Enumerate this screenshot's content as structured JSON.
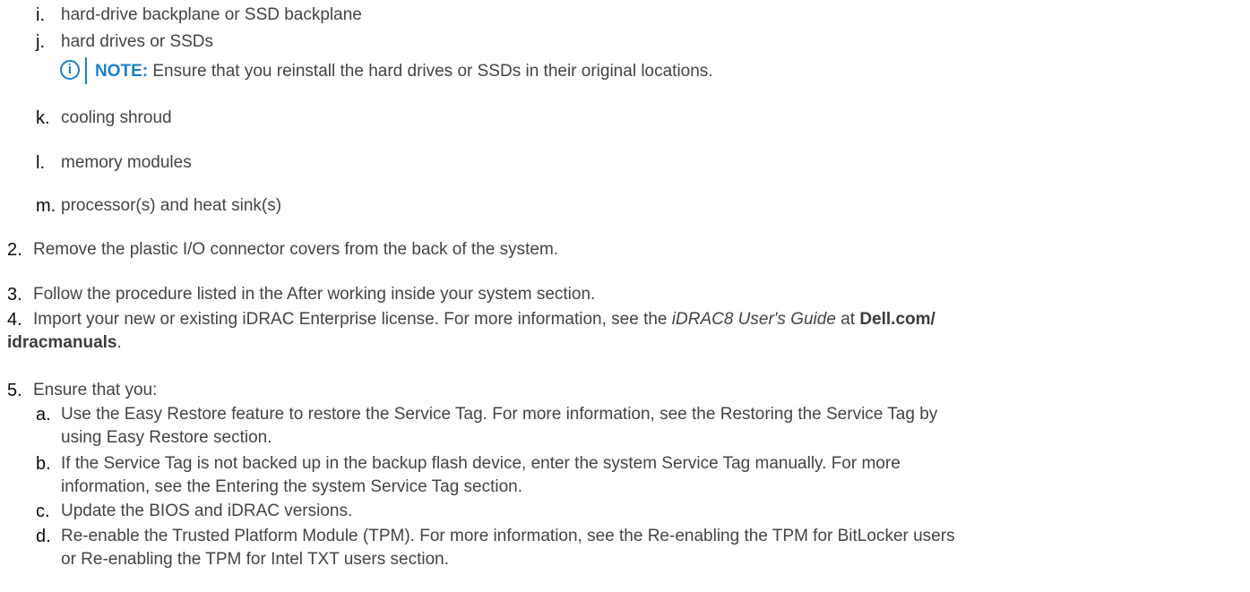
{
  "sub_items_top": [
    {
      "marker": "i.",
      "text": "hard-drive backplane or SSD backplane"
    },
    {
      "marker": "j.",
      "text": "hard drives or SSDs"
    }
  ],
  "note": {
    "icon": "info-icon",
    "label": "NOTE:",
    "text": " Ensure that you reinstall the hard drives or SSDs in their original locations."
  },
  "sub_items_bottom": [
    {
      "marker": "k.",
      "text": "cooling shroud"
    },
    {
      "marker": "l.",
      "text": "memory modules"
    },
    {
      "marker": "m.",
      "text": "processor(s) and heat sink(s)"
    }
  ],
  "steps": {
    "s2": {
      "marker": "2.",
      "text": "Remove the plastic I/O connector covers from the back of the system."
    },
    "s3": {
      "marker": "3.",
      "text": "Follow the procedure listed in the After working inside your system section."
    },
    "s4": {
      "marker": "4.",
      "text_a": "Import your new or existing iDRAC Enterprise license. For more information, see the ",
      "guide": "iDRAC8 User's Guide",
      "text_b": " at ",
      "link_a": "Dell.com/",
      "link_b": "idracmanuals",
      "text_c": "."
    },
    "s5": {
      "marker": "5.",
      "text": "Ensure that you:",
      "subs": [
        {
          "marker": "a.",
          "line1": "Use the Easy Restore feature to restore the Service Tag. For more information, see the Restoring the Service Tag by",
          "line2": "using Easy Restore section."
        },
        {
          "marker": "b.",
          "line1": "If the Service Tag is not backed up in the backup flash device, enter the system Service Tag manually. For more",
          "line2": "information, see the Entering the system Service Tag section."
        },
        {
          "marker": "c.",
          "line1": "Update the BIOS and iDRAC versions.",
          "line2": ""
        },
        {
          "marker": "d.",
          "line1": "Re-enable the Trusted Platform Module (TPM). For more information, see the Re-enabling the TPM for BitLocker users",
          "line2": "or Re-enabling the TPM for Intel TXT users section."
        }
      ]
    }
  }
}
